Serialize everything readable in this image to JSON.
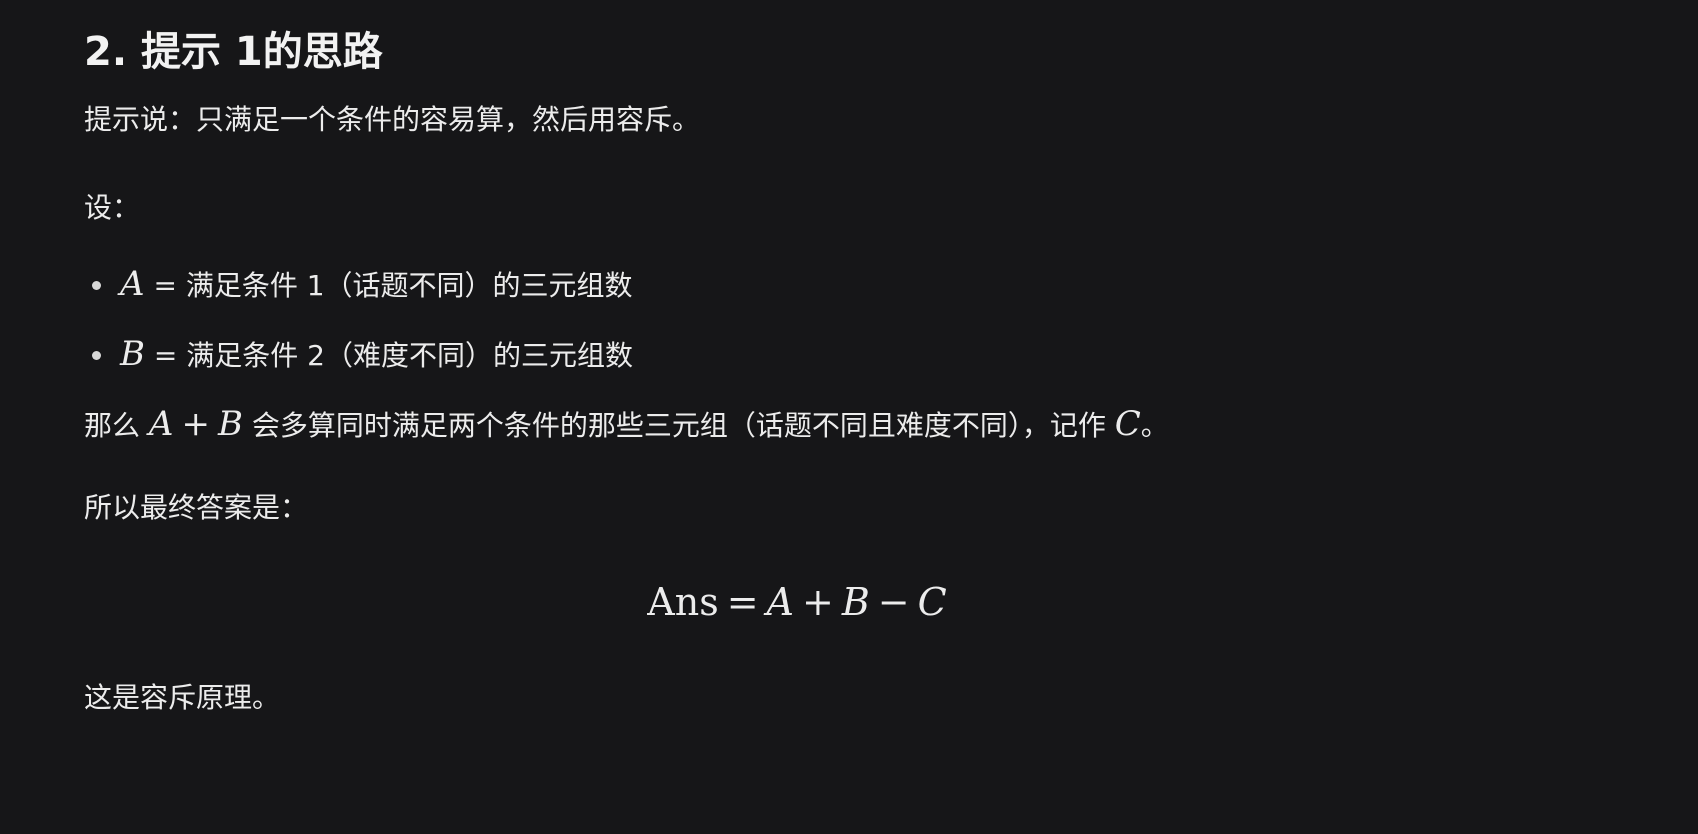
{
  "heading": "2. 提示 1的思路",
  "intro": "提示说：只满足一个条件的容易算，然后用容斥。",
  "let": "设：",
  "bullets": [
    {
      "var": "A",
      "eq": " = ",
      "text": "满足条件 1（话题不同）的三元组数"
    },
    {
      "var": "B",
      "eq": " = ",
      "text": "满足条件 2（难度不同）的三元组数"
    }
  ],
  "overlap": {
    "prefix": "那么 ",
    "var_a": "A",
    "plus": "+",
    "var_b": "B",
    "middle": " 会多算同时满足两个条件的那些三元组（话题不同且难度不同），记作 ",
    "var_c": "C",
    "suffix": "。"
  },
  "answer_intro": "所以最终答案是：",
  "formula": {
    "lhs": "Ans",
    "eq": "=",
    "a": "A",
    "plus": "+",
    "b": "B",
    "minus": "−",
    "c": "C"
  },
  "conclusion": "这是容斥原理。"
}
